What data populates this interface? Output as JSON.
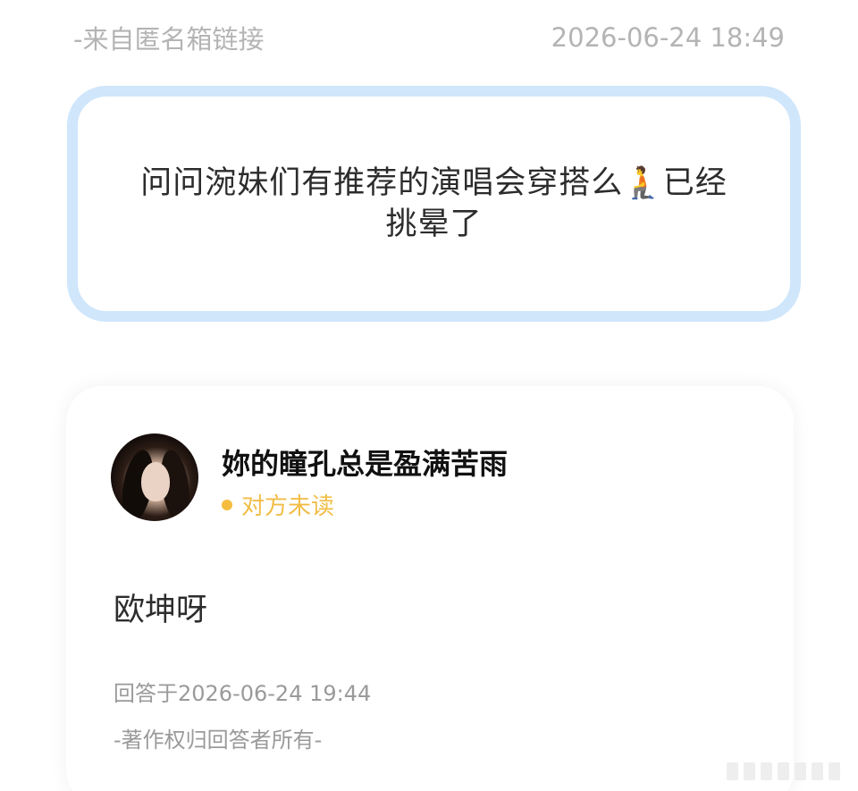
{
  "header": {
    "source": "-来自匿名箱链接",
    "timestamp": "2026-06-24 18:49"
  },
  "question": {
    "text": "问问涴妹们有推荐的演唱会穿搭么🧎已经挑晕了",
    "border_color": "#cfe6fb"
  },
  "answer": {
    "username": "妳的瞳孔总是盈满苦雨",
    "status": "对方未读",
    "status_color": "#f2bd47",
    "content": "欧坤呀",
    "answered_at": "回答于2026-06-24 19:44",
    "copyright": "-著作权归回答者所有-"
  }
}
